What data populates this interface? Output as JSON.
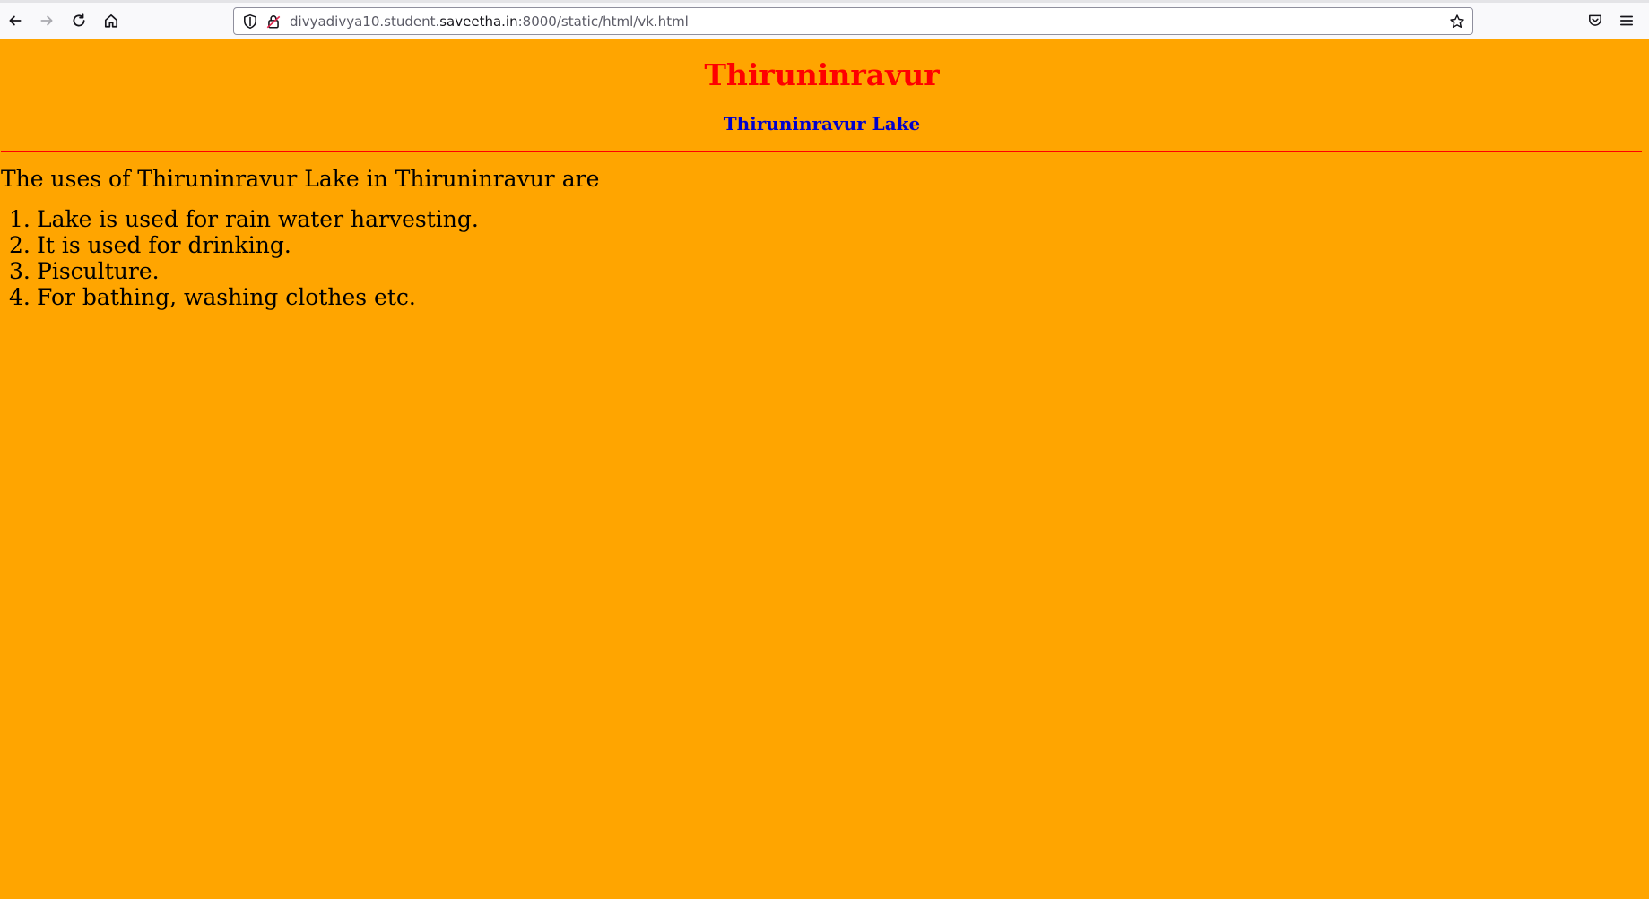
{
  "browser": {
    "url_prefix": "divyadivya10.student.",
    "url_host": "saveetha.in",
    "url_suffix": ":8000/static/html/vk.html",
    "icons": {
      "back": "back-arrow-icon",
      "forward": "forward-arrow-icon",
      "reload": "reload-icon",
      "home": "home-icon",
      "shield": "shield-icon",
      "lock": "lock-icon",
      "bookmark": "star-icon",
      "pocket": "pocket-icon",
      "menu": "hamburger-menu-icon"
    }
  },
  "page": {
    "title": "Thiruninravur",
    "subtitle": "Thiruninravur Lake",
    "intro": "The uses of Thiruninravur Lake in Thiruninravur are",
    "uses": [
      {
        "num": "1.",
        "text": "Lake is used for rain water harvesting."
      },
      {
        "num": "2.",
        "text": "It is used for drinking."
      },
      {
        "num": "3.",
        "text": "Pisculture."
      },
      {
        "num": "4.",
        "text": "For bathing, washing clothes etc."
      }
    ]
  },
  "colors": {
    "background": "#ffa500",
    "title": "#ff0000",
    "subtitle": "#0000cd",
    "rule": "#ff0000",
    "text": "#000000"
  }
}
